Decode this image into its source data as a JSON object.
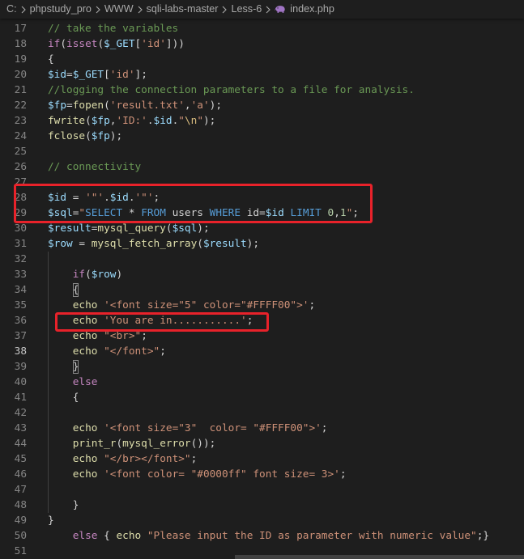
{
  "breadcrumb": {
    "items": [
      "C:",
      "phpstudy_pro",
      "WWW",
      "sqli-labs-master",
      "Less-6"
    ],
    "file": "index.php",
    "separator_icon": "chevron-right-icon",
    "file_icon": "php-file-icon"
  },
  "theme": {
    "background": "#1e1e1e",
    "line_number": "#858585",
    "line_number_active": "#c6c6c6",
    "breadcrumb_text": "#a9a9a9",
    "annotation_box": "#e8222a",
    "indent_guide": "#404040",
    "bracket_match_border": "#888888",
    "php_icon": "#a074c4",
    "syntax": {
      "comment": "#6a9955",
      "keyword": "#c586c0",
      "function": "#dcdcaa",
      "variable": "#9cdcfe",
      "string": "#ce9178",
      "sql-keyword": "#569cd6",
      "number": "#b5cea8",
      "escape": "#d7ba7d",
      "plain": "#d4d4d4"
    }
  },
  "editor": {
    "active_line": 38,
    "lines": [
      {
        "n": 17,
        "tokens": [
          {
            "c": "comment",
            "t": "// take the variables"
          }
        ]
      },
      {
        "n": 18,
        "tokens": [
          {
            "c": "keyword",
            "t": "if"
          },
          {
            "c": "plain",
            "t": "("
          },
          {
            "c": "keyword",
            "t": "isset"
          },
          {
            "c": "plain",
            "t": "("
          },
          {
            "c": "variable",
            "t": "$_GET"
          },
          {
            "c": "plain",
            "t": "["
          },
          {
            "c": "string",
            "t": "'id'"
          },
          {
            "c": "plain",
            "t": "]))"
          }
        ]
      },
      {
        "n": 19,
        "tokens": [
          {
            "c": "plain",
            "t": "{"
          }
        ]
      },
      {
        "n": 20,
        "tokens": [
          {
            "c": "variable",
            "t": "$id"
          },
          {
            "c": "plain",
            "t": "="
          },
          {
            "c": "variable",
            "t": "$_GET"
          },
          {
            "c": "plain",
            "t": "["
          },
          {
            "c": "string",
            "t": "'id'"
          },
          {
            "c": "plain",
            "t": "];"
          }
        ]
      },
      {
        "n": 21,
        "tokens": [
          {
            "c": "comment",
            "t": "//logging the connection parameters to a file for analysis."
          }
        ]
      },
      {
        "n": 22,
        "tokens": [
          {
            "c": "variable",
            "t": "$fp"
          },
          {
            "c": "plain",
            "t": "="
          },
          {
            "c": "function",
            "t": "fopen"
          },
          {
            "c": "plain",
            "t": "("
          },
          {
            "c": "string",
            "t": "'result.txt'"
          },
          {
            "c": "plain",
            "t": ","
          },
          {
            "c": "string",
            "t": "'a'"
          },
          {
            "c": "plain",
            "t": ");"
          }
        ]
      },
      {
        "n": 23,
        "tokens": [
          {
            "c": "function",
            "t": "fwrite"
          },
          {
            "c": "plain",
            "t": "("
          },
          {
            "c": "variable",
            "t": "$fp"
          },
          {
            "c": "plain",
            "t": ","
          },
          {
            "c": "string",
            "t": "'ID:'"
          },
          {
            "c": "plain",
            "t": "."
          },
          {
            "c": "variable",
            "t": "$id"
          },
          {
            "c": "plain",
            "t": "."
          },
          {
            "c": "string",
            "t": "\""
          },
          {
            "c": "escape",
            "t": "\\n"
          },
          {
            "c": "string",
            "t": "\""
          },
          {
            "c": "plain",
            "t": ");"
          }
        ]
      },
      {
        "n": 24,
        "tokens": [
          {
            "c": "function",
            "t": "fclose"
          },
          {
            "c": "plain",
            "t": "("
          },
          {
            "c": "variable",
            "t": "$fp"
          },
          {
            "c": "plain",
            "t": ");"
          }
        ]
      },
      {
        "n": 25,
        "tokens": []
      },
      {
        "n": 26,
        "tokens": [
          {
            "c": "comment",
            "t": "// connectivity"
          }
        ]
      },
      {
        "n": 27,
        "tokens": []
      },
      {
        "n": 28,
        "tokens": [
          {
            "c": "variable",
            "t": "$id"
          },
          {
            "c": "plain",
            "t": " = "
          },
          {
            "c": "string",
            "t": "'\"'"
          },
          {
            "c": "plain",
            "t": "."
          },
          {
            "c": "variable",
            "t": "$id"
          },
          {
            "c": "plain",
            "t": "."
          },
          {
            "c": "string",
            "t": "'\"'"
          },
          {
            "c": "plain",
            "t": ";"
          }
        ]
      },
      {
        "n": 29,
        "tokens": [
          {
            "c": "variable",
            "t": "$sql"
          },
          {
            "c": "plain",
            "t": "="
          },
          {
            "c": "string",
            "t": "\""
          },
          {
            "c": "sql-keyword",
            "t": "SELECT"
          },
          {
            "c": "plain",
            "t": " * "
          },
          {
            "c": "sql-keyword",
            "t": "FROM"
          },
          {
            "c": "plain",
            "t": " users "
          },
          {
            "c": "sql-keyword",
            "t": "WHERE"
          },
          {
            "c": "plain",
            "t": " id="
          },
          {
            "c": "variable",
            "t": "$id"
          },
          {
            "c": "plain",
            "t": " "
          },
          {
            "c": "sql-keyword",
            "t": "LIMIT"
          },
          {
            "c": "plain",
            "t": " "
          },
          {
            "c": "number",
            "t": "0"
          },
          {
            "c": "plain",
            "t": ","
          },
          {
            "c": "number",
            "t": "1"
          },
          {
            "c": "string",
            "t": "\""
          },
          {
            "c": "plain",
            "t": ";"
          }
        ]
      },
      {
        "n": 30,
        "tokens": [
          {
            "c": "variable",
            "t": "$result"
          },
          {
            "c": "plain",
            "t": "="
          },
          {
            "c": "function",
            "t": "mysql_query"
          },
          {
            "c": "plain",
            "t": "("
          },
          {
            "c": "variable",
            "t": "$sql"
          },
          {
            "c": "plain",
            "t": ");"
          }
        ]
      },
      {
        "n": 31,
        "tokens": [
          {
            "c": "variable",
            "t": "$row"
          },
          {
            "c": "plain",
            "t": " = "
          },
          {
            "c": "function",
            "t": "mysql_fetch_array"
          },
          {
            "c": "plain",
            "t": "("
          },
          {
            "c": "variable",
            "t": "$result"
          },
          {
            "c": "plain",
            "t": ");"
          }
        ]
      },
      {
        "n": 32,
        "tokens": []
      },
      {
        "n": 33,
        "tokens": [
          {
            "c": "plain",
            "t": "    "
          },
          {
            "c": "keyword",
            "t": "if"
          },
          {
            "c": "plain",
            "t": "("
          },
          {
            "c": "variable",
            "t": "$row"
          },
          {
            "c": "plain",
            "t": ")"
          }
        ]
      },
      {
        "n": 34,
        "tokens": [
          {
            "c": "plain",
            "t": "    "
          },
          {
            "c": "plain",
            "t": "{",
            "m": true
          }
        ]
      },
      {
        "n": 35,
        "tokens": [
          {
            "c": "plain",
            "t": "    "
          },
          {
            "c": "function",
            "t": "echo"
          },
          {
            "c": "plain",
            "t": " "
          },
          {
            "c": "string",
            "t": "'<font size=\"5\" color=\"#FFFF00\">'"
          },
          {
            "c": "plain",
            "t": ";"
          }
        ]
      },
      {
        "n": 36,
        "tokens": [
          {
            "c": "plain",
            "t": "    "
          },
          {
            "c": "function",
            "t": "echo"
          },
          {
            "c": "plain",
            "t": " "
          },
          {
            "c": "string",
            "t": "'You are in...........'"
          },
          {
            "c": "plain",
            "t": ";"
          }
        ]
      },
      {
        "n": 37,
        "tokens": [
          {
            "c": "plain",
            "t": "    "
          },
          {
            "c": "function",
            "t": "echo"
          },
          {
            "c": "plain",
            "t": " "
          },
          {
            "c": "string",
            "t": "\"<br>\""
          },
          {
            "c": "plain",
            "t": ";"
          }
        ]
      },
      {
        "n": 38,
        "tokens": [
          {
            "c": "plain",
            "t": "    "
          },
          {
            "c": "function",
            "t": "echo"
          },
          {
            "c": "plain",
            "t": " "
          },
          {
            "c": "string",
            "t": "\"</font>\""
          },
          {
            "c": "plain",
            "t": ";"
          }
        ]
      },
      {
        "n": 39,
        "tokens": [
          {
            "c": "plain",
            "t": "    "
          },
          {
            "c": "plain",
            "t": "}",
            "m": true
          }
        ]
      },
      {
        "n": 40,
        "tokens": [
          {
            "c": "plain",
            "t": "    "
          },
          {
            "c": "keyword",
            "t": "else"
          }
        ]
      },
      {
        "n": 41,
        "tokens": [
          {
            "c": "plain",
            "t": "    "
          },
          {
            "c": "plain",
            "t": "{"
          }
        ]
      },
      {
        "n": 42,
        "tokens": []
      },
      {
        "n": 43,
        "tokens": [
          {
            "c": "plain",
            "t": "    "
          },
          {
            "c": "function",
            "t": "echo"
          },
          {
            "c": "plain",
            "t": " "
          },
          {
            "c": "string",
            "t": "'<font size=\"3\"  color= \"#FFFF00\">'"
          },
          {
            "c": "plain",
            "t": ";"
          }
        ]
      },
      {
        "n": 44,
        "tokens": [
          {
            "c": "plain",
            "t": "    "
          },
          {
            "c": "function",
            "t": "print_r"
          },
          {
            "c": "plain",
            "t": "("
          },
          {
            "c": "function",
            "t": "mysql_error"
          },
          {
            "c": "plain",
            "t": "());"
          }
        ]
      },
      {
        "n": 45,
        "tokens": [
          {
            "c": "plain",
            "t": "    "
          },
          {
            "c": "function",
            "t": "echo"
          },
          {
            "c": "plain",
            "t": " "
          },
          {
            "c": "string",
            "t": "\"</br></font>\""
          },
          {
            "c": "plain",
            "t": ";"
          }
        ]
      },
      {
        "n": 46,
        "tokens": [
          {
            "c": "plain",
            "t": "    "
          },
          {
            "c": "function",
            "t": "echo"
          },
          {
            "c": "plain",
            "t": " "
          },
          {
            "c": "string",
            "t": "'<font color= \"#0000ff\" font size= 3>'"
          },
          {
            "c": "plain",
            "t": ";"
          }
        ]
      },
      {
        "n": 47,
        "tokens": []
      },
      {
        "n": 48,
        "tokens": [
          {
            "c": "plain",
            "t": "    "
          },
          {
            "c": "plain",
            "t": "}"
          }
        ]
      },
      {
        "n": 49,
        "tokens": [
          {
            "c": "plain",
            "t": "}"
          }
        ]
      },
      {
        "n": 50,
        "tokens": [
          {
            "c": "plain",
            "t": "    "
          },
          {
            "c": "keyword",
            "t": "else"
          },
          {
            "c": "plain",
            "t": " { "
          },
          {
            "c": "function",
            "t": "echo"
          },
          {
            "c": "plain",
            "t": " "
          },
          {
            "c": "string",
            "t": "\"Please input the ID as parameter with numeric value\""
          },
          {
            "c": "plain",
            "t": ";}"
          }
        ]
      },
      {
        "n": 51,
        "tokens": []
      }
    ]
  }
}
